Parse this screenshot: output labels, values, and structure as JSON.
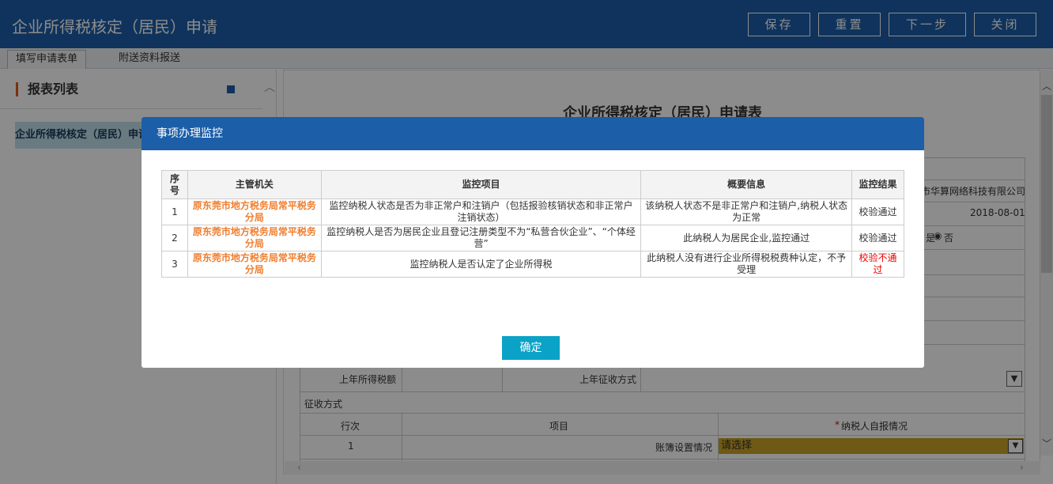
{
  "app": {
    "title": "企业所得税核定（居民）申请"
  },
  "toolbar": {
    "save": "保存",
    "reset": "重置",
    "next": "下一步",
    "close": "关闭"
  },
  "tabs": [
    {
      "label": "填写申请表单"
    },
    {
      "label": "附送资料报送"
    }
  ],
  "sidebar": {
    "heading": "报表列表",
    "item": "企业所得税核定（居民）申请表"
  },
  "form": {
    "title": "企业所得税核定（居民）申请表",
    "company_suffix": "市华算网络科技有限公司",
    "date": "2018-08-01",
    "radio_yes": "是",
    "radio_no": "否",
    "last_year_tax_label": "上年所得税额",
    "last_year_method_label": "上年征收方式",
    "collection_method": "征收方式",
    "col_line": "行次",
    "col_item": "项目",
    "col_self_report": "纳税人自报情况",
    "required_mark": "*",
    "row1_no": "1",
    "row1_item": "账簿设置情况",
    "row1_select": "请选择"
  },
  "modal": {
    "title": "事项办理监控",
    "headers": {
      "seq": "序号",
      "authority": "主管机关",
      "item": "监控项目",
      "summary": "概要信息",
      "result": "监控结果"
    },
    "rows": [
      {
        "seq": "1",
        "authority": "原东莞市地方税务局常平税务分局",
        "item": "监控纳税人状态是否为非正常户和注销户（包括报验核销状态和非正常户注销状态）",
        "summary": "该纳税人状态不是非正常户和注销户,纳税人状态为正常",
        "result": "校验通过"
      },
      {
        "seq": "2",
        "authority": "原东莞市地方税务局常平税务分局",
        "item": "监控纳税人是否为居民企业且登记注册类型不为“私营合伙企业”、“个体经营”",
        "summary": "此纳税人为居民企业,监控通过",
        "result": "校验通过"
      },
      {
        "seq": "3",
        "authority": "原东莞市地方税务局常平税务分局",
        "item": "监控纳税人是否认定了企业所得税",
        "summary": "此纳税人没有进行企业所得税税费种认定，不予受理",
        "result": "校验不通过"
      }
    ],
    "confirm": "确定"
  },
  "colors": {
    "brand": "#1c5ea8",
    "authority_text": "#ef7d2e",
    "fail_text": "#e00000",
    "confirm": "#0aa2c7",
    "select_highlight": "#c9a227"
  }
}
